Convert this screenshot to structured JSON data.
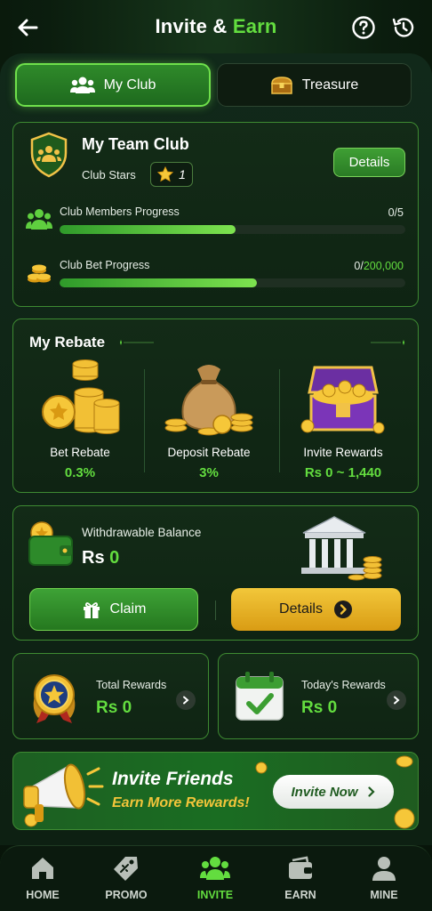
{
  "header": {
    "title_part1": "Invite &",
    "title_part2": "Earn"
  },
  "tabs": [
    {
      "label": "My Club",
      "icon": "group-icon",
      "active": true
    },
    {
      "label": "Treasure",
      "icon": "treasure-chest-icon",
      "active": false
    }
  ],
  "club": {
    "title": "My Team Club",
    "stars_label": "Club Stars",
    "stars_count": "1",
    "details_label": "Details",
    "members": {
      "label": "Club Members Progress",
      "value": "0/5",
      "fraction": 0.51
    },
    "bet": {
      "label": "Club Bet Progress",
      "current": "0/",
      "target": "200,000",
      "fraction": 0.57
    }
  },
  "rebate": {
    "title": "My Rebate",
    "items": [
      {
        "label": "Bet Rebate",
        "value": "0.3%",
        "icon": "coin-stack-icon"
      },
      {
        "label": "Deposit Rebate",
        "value": "3%",
        "icon": "money-bag-icon"
      },
      {
        "label": "Invite Rewards",
        "value": "Rs 0 ~ 1,440",
        "icon": "treasure-chest-icon"
      }
    ]
  },
  "balance": {
    "label": "Withdrawable Balance",
    "currency": "Rs",
    "value": "0",
    "claim_label": "Claim",
    "details_label": "Details"
  },
  "rewards": {
    "total": {
      "label": "Total Rewards",
      "value": "Rs 0"
    },
    "today": {
      "label": "Today's Rewards",
      "value": "Rs 0"
    }
  },
  "invite": {
    "line1": "Invite Friends",
    "line2": "Earn More Rewards!",
    "button": "Invite Now"
  },
  "nav": [
    {
      "label": "HOME",
      "icon": "home-icon"
    },
    {
      "label": "PROMO",
      "icon": "promo-tag-icon"
    },
    {
      "label": "INVITE",
      "icon": "group-icon",
      "active": true
    },
    {
      "label": "EARN",
      "icon": "wallet-icon"
    },
    {
      "label": "MINE",
      "icon": "person-icon"
    }
  ],
  "colors": {
    "accent": "#63dd3f",
    "gold": "#f3c53a",
    "background": "#0d2012"
  }
}
